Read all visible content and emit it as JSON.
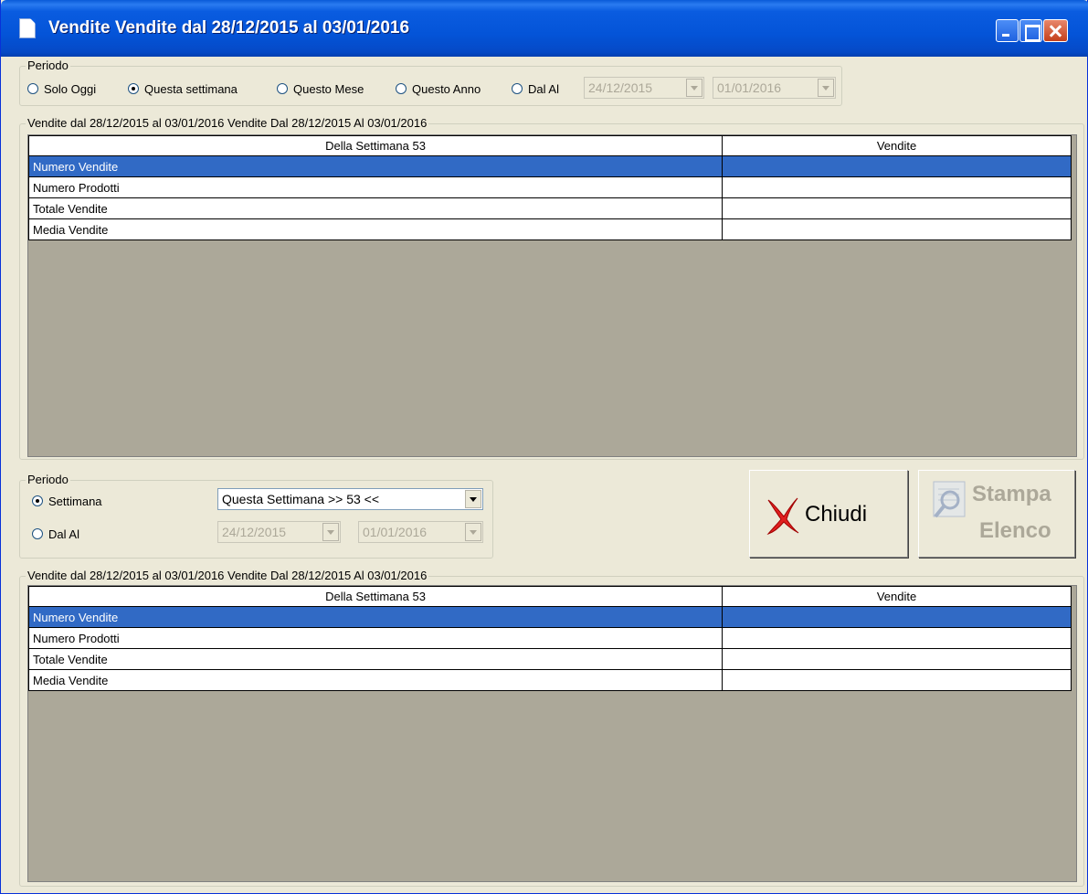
{
  "window": {
    "title": "Vendite Vendite dal 28/12/2015 al 03/01/2016"
  },
  "top_period": {
    "legend": "Periodo",
    "options": [
      "Solo Oggi",
      "Questa settimana",
      "Questo Mese",
      "Questo Anno",
      "Dal Al"
    ],
    "selected": "Questa settimana",
    "date_from": "24/12/2015",
    "date_to": "01/01/2016"
  },
  "grid1": {
    "legend": "Vendite dal 28/12/2015 al 03/01/2016 Vendite Dal 28/12/2015 Al 03/01/2016",
    "columns": [
      "Della Settimana 53",
      "Vendite"
    ],
    "rows": [
      [
        "Numero Vendite",
        ""
      ],
      [
        "Numero Prodotti",
        ""
      ],
      [
        "Totale Vendite",
        ""
      ],
      [
        "Media Vendite",
        ""
      ]
    ]
  },
  "bottom_period": {
    "legend": "Periodo",
    "option_week": "Settimana",
    "option_range": "Dal Al",
    "selected": "Settimana",
    "week_value": "Questa Settimana >> 53 <<",
    "date_from": "24/12/2015",
    "date_to": "01/01/2016"
  },
  "buttons": {
    "close_label": "Chiudi",
    "print_line1": "Stampa",
    "print_line2": "Elenco"
  },
  "grid2": {
    "legend": "Vendite dal 28/12/2015 al 03/01/2016 Vendite Dal 28/12/2015 Al 03/01/2016",
    "columns": [
      "Della Settimana 53",
      "Vendite"
    ],
    "rows": [
      [
        "Numero Vendite",
        ""
      ],
      [
        "Numero Prodotti",
        ""
      ],
      [
        "Totale Vendite",
        ""
      ],
      [
        "Media Vendite",
        ""
      ]
    ]
  },
  "colors": {
    "titlebar": "#0a5ce0",
    "selection": "#316ac5",
    "grid_background": "#aca899",
    "close_icon": "#e02020"
  }
}
